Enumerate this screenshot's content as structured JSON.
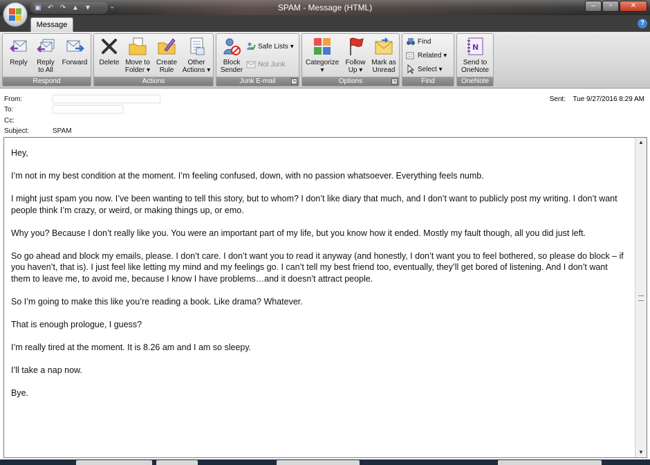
{
  "window": {
    "title": "SPAM - Message (HTML)",
    "controls": {
      "minimize": "–",
      "restore": "▫",
      "close": "✕"
    }
  },
  "quick_access": {
    "more": "⌄"
  },
  "tabs": [
    {
      "label": "Message",
      "selected": true
    }
  ],
  "help_label": "?",
  "ribbon": {
    "respond": {
      "title": "Respond",
      "reply": "Reply",
      "reply_all": [
        "Reply",
        "to All"
      ],
      "forward": "Forward"
    },
    "actions": {
      "title": "Actions",
      "delete": "Delete",
      "move_to_folder": [
        "Move to",
        "Folder ▾"
      ],
      "create_rule": [
        "Create",
        "Rule"
      ],
      "other_actions": [
        "Other",
        "Actions ▾"
      ]
    },
    "junk": {
      "title": "Junk E-mail",
      "block_sender": [
        "Block",
        "Sender"
      ],
      "safe_lists": "Safe Lists ▾",
      "not_junk": "Not Junk"
    },
    "options": {
      "title": "Options",
      "categorize": [
        "Categorize",
        "▾"
      ],
      "follow_up": [
        "Follow",
        "Up ▾"
      ],
      "mark_as_unread": [
        "Mark as",
        "Unread"
      ]
    },
    "find": {
      "title": "Find",
      "find": "Find",
      "related": "Related ▾",
      "select": "Select ▾"
    },
    "onenote": {
      "title": "OneNote",
      "send_to_onenote": [
        "Send to",
        "OneNote"
      ]
    }
  },
  "header": {
    "from_label": "From:",
    "to_label": "To:",
    "cc_label": "Cc:",
    "subject_label": "Subject:",
    "subject": "SPAM",
    "sent_label": "Sent:",
    "sent_value": "Tue 9/27/2016 8:29 AM"
  },
  "body": [
    "Hey,",
    "I’m not in my best condition at the moment. I’m feeling confused, down, with no passion whatsoever. Everything feels numb.",
    "I might just spam you now. I’ve been wanting to tell this story, but to whom? I don’t like diary that much, and I don’t want to publicly post my writing. I don’t want people think I’m crazy, or weird, or making things up, or emo.",
    "Why you? Because I don’t really like you. You were an important part of my life, but you know how it ended. Mostly my fault though, all you did just left.",
    "So go ahead and block my emails, please. I don’t care. I don’t want you to read it anyway (and honestly, I don’t want you to feel bothered, so please do block – if you haven’t, that is). I just feel like letting my mind and my feelings go. I can’t tell my best friend too, eventually, they’ll get bored of listening. And I don’t want them to leave me, to avoid me, because I know I have problems…and it doesn’t attract people.",
    "So I’m going to make this like you’re reading a book. Like drama? Whatever.",
    "That is enough prologue, I guess?",
    "I’m really tired at the moment. It is 8.26 am and I am so sleepy.",
    "I’ll take a nap now.",
    "Bye."
  ],
  "colors": {
    "ribbon_title": "#7c7c7c",
    "titlebar": "#3e3e3e",
    "help": "#3c87d8"
  }
}
